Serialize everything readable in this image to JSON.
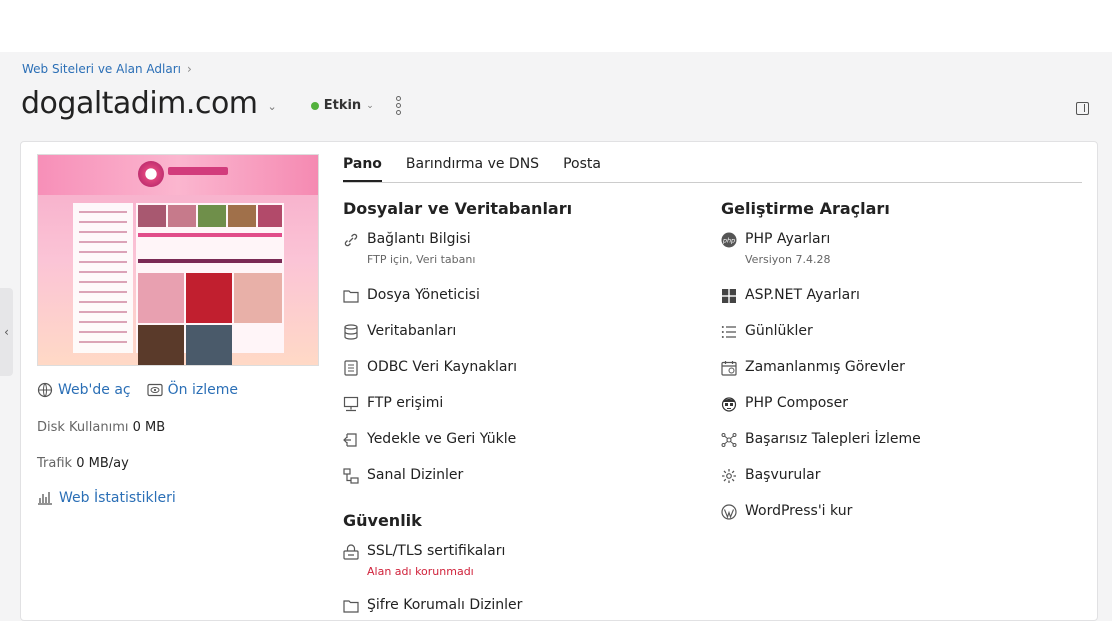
{
  "breadcrumb": {
    "label": "Web Siteleri ve Alan Adları"
  },
  "header": {
    "title": "dogaltadim.com",
    "status": "Etkin",
    "status_color": "#53b13d"
  },
  "left": {
    "open_web": "Web'de aç",
    "preview": "Ön izleme",
    "disk_label": "Disk Kullanımı",
    "disk_value": "0 MB",
    "traffic_label": "Trafik",
    "traffic_value": "0 MB/ay",
    "stats": "Web İstatistikleri"
  },
  "tabs": [
    "Pano",
    "Barındırma ve DNS",
    "Posta"
  ],
  "files": {
    "heading": "Dosyalar ve Veritabanları",
    "items": [
      {
        "label": "Bağlantı Bilgisi",
        "sub": "FTP için, Veri tabanı",
        "icon": "link-icon"
      },
      {
        "label": "Dosya Yöneticisi",
        "icon": "folder-icon"
      },
      {
        "label": "Veritabanları",
        "icon": "database-icon"
      },
      {
        "label": "ODBC Veri Kaynakları",
        "icon": "odbc-icon"
      },
      {
        "label": "FTP erişimi",
        "icon": "ftp-icon"
      },
      {
        "label": "Yedekle ve Geri Yükle",
        "icon": "backup-icon"
      },
      {
        "label": "Sanal Dizinler",
        "icon": "virtual-directories-icon"
      }
    ]
  },
  "security": {
    "heading": "Güvenlik",
    "items": [
      {
        "label": "SSL/TLS sertifikaları",
        "sub": "Alan adı korunmadı",
        "icon": "certificate-icon"
      },
      {
        "label": "Şifre Korumalı Dizinler",
        "icon": "folder-lock-icon"
      }
    ]
  },
  "dev": {
    "heading": "Geliştirme Araçları",
    "items": [
      {
        "label": "PHP Ayarları",
        "sub": "Versiyon 7.4.28",
        "icon": "php-icon"
      },
      {
        "label": "ASP.NET Ayarları",
        "icon": "windows-icon"
      },
      {
        "label": "Günlükler",
        "icon": "list-icon"
      },
      {
        "label": "Zamanlanmış Görevler",
        "icon": "calendar-icon"
      },
      {
        "label": "PHP Composer",
        "icon": "composer-icon"
      },
      {
        "label": "Başarısız Talepleri İzleme",
        "icon": "network-icon"
      },
      {
        "label": "Başvurular",
        "icon": "gear-icon"
      },
      {
        "label": "WordPress'i kur",
        "icon": "wordpress-icon"
      }
    ]
  }
}
